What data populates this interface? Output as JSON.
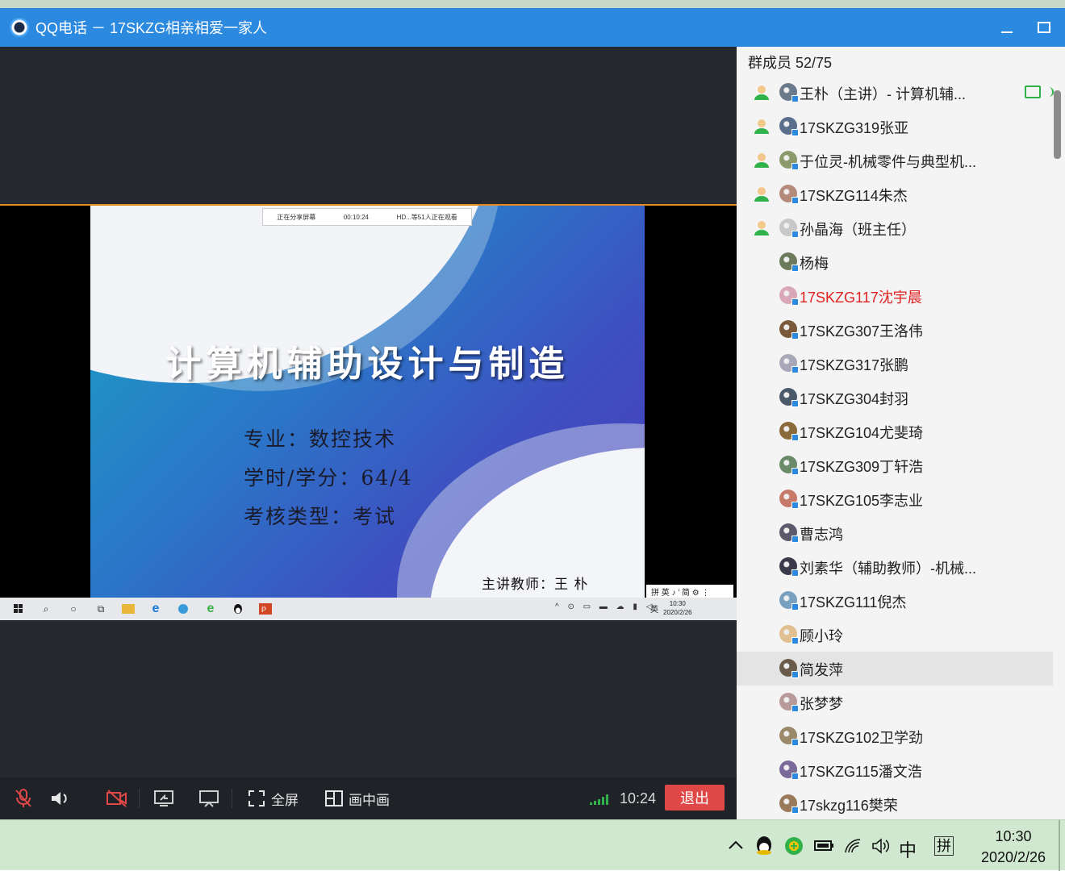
{
  "window": {
    "title": "QQ电话 － 17SKZG相亲相爱一家人"
  },
  "slide": {
    "share_status": "正在分享屏幕",
    "share_time": "00:10:24",
    "share_viewers": "HD...等51人正在观看",
    "title": "计算机辅助设计与制造",
    "line1": "专业：数控技术",
    "line2": "学时/学分：64/4",
    "line3": "考核类型：考试",
    "teacher": "主讲教师：王 朴",
    "ime": "拼 英 ♪ ’ 简 ⚙ ⋮",
    "taskbar_lang": "英",
    "taskbar_time": "10:30",
    "taskbar_date": "2020/2/26"
  },
  "controls": {
    "fullscreen_label": "全屏",
    "pip_label": "画中画",
    "call_time": "10:24",
    "exit_label": "退出"
  },
  "panel": {
    "header": "群成员 52/75",
    "members": [
      {
        "name": "王朴（主讲）- 计算机辅...",
        "mic": true
      },
      {
        "name": "17SKZG319张亚",
        "mic": true
      },
      {
        "name": "于位灵-机械零件与典型机...",
        "mic": true
      },
      {
        "name": "17SKZG114朱杰",
        "mic": true
      },
      {
        "name": "孙晶海（班主任）",
        "mic": true
      },
      {
        "name": "杨梅",
        "mic": false
      },
      {
        "name": "17SKZG117沈宇晨",
        "mic": false,
        "highlight_color": "#e02020"
      },
      {
        "name": "17SKZG307王洛伟",
        "mic": false
      },
      {
        "name": "17SKZG317张鹏",
        "mic": false
      },
      {
        "name": "17SKZG304封羽",
        "mic": false
      },
      {
        "name": "17SKZG104尤斐琦",
        "mic": false
      },
      {
        "name": "17SKZG309丁轩浩",
        "mic": false
      },
      {
        "name": "17SKZG105李志业",
        "mic": false
      },
      {
        "name": "曹志鸿",
        "mic": false
      },
      {
        "name": "刘素华（辅助教师）-机械...",
        "mic": false
      },
      {
        "name": "17SKZG111倪杰",
        "mic": false
      },
      {
        "name": "顾小玲",
        "mic": false
      },
      {
        "name": "简发萍",
        "mic": false,
        "selected": true
      },
      {
        "name": "张梦梦",
        "mic": false
      },
      {
        "name": "17SKZG102卫学劲",
        "mic": false
      },
      {
        "name": "17SKZG115潘文浩",
        "mic": false
      },
      {
        "name": "17skzg116樊荣",
        "mic": false
      }
    ]
  },
  "taskbar": {
    "ime_label": "中",
    "ime_mode": "拼",
    "time": "10:30",
    "date": "2020/2/26"
  },
  "colors": {
    "titlebar": "#2b8ae0",
    "exit_button": "#e04848",
    "signal": "#2fb24a",
    "share_border": "#e58a1f"
  }
}
